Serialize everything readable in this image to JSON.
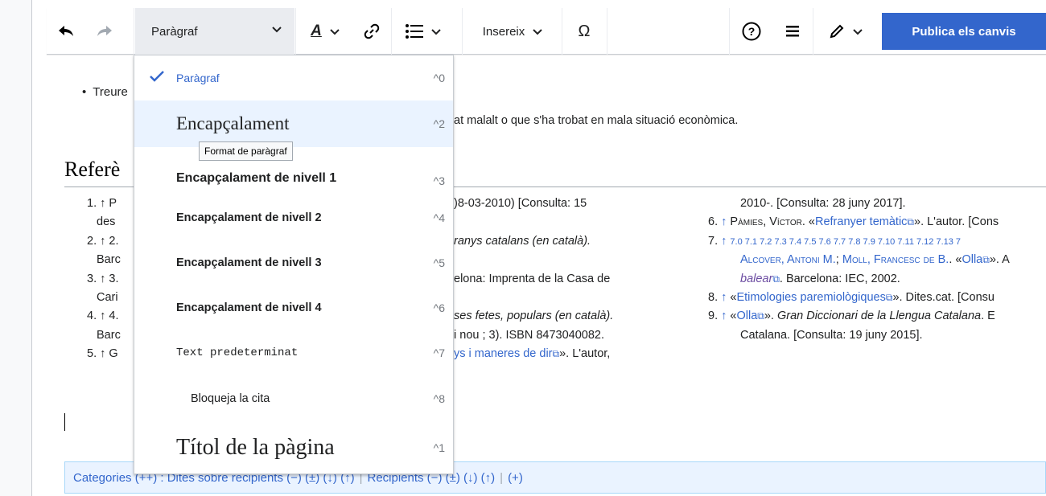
{
  "toolbar": {
    "undo_icon": "undo-arrow",
    "redo_icon": "redo-arrow",
    "paragraph_label": "Paràgraf",
    "style_icon": "text-style-A",
    "link_icon": "link-chain",
    "list_icon": "bulleted-list",
    "insert_label": "Insereix",
    "special_char_label": "Ω",
    "help_icon": "question-circle",
    "menu_icon": "hamburger",
    "edit_icon": "pencil",
    "publish_label": "Publica els canvis",
    "accent_color": "#3366cc"
  },
  "content": {
    "bullet_text": "Treure",
    "frag1": "at malalt o que s'ha trobat en mala situació econòmica.",
    "heading": "Referè",
    "left_refs": [
      "1. ↑ P",
      "des",
      "2. ↑ 2.",
      "Barc",
      "3. ↑ 3.",
      "Cari",
      "4. ↑ 4.",
      "Barc",
      "5. ↑ G"
    ],
    "mid_refs": [
      ")8-03-2010) [Consulta: 15",
      "",
      "ranys catalans (en català).",
      "",
      "elona: Imprenta de la Casa de",
      "",
      "ses fetes, populars (en català).",
      "i nou ; 3). ISBN 8473040082.",
      "ys i maneres de dir"
    ],
    "mid_ref8_suffix": "». L'autor,",
    "right_refs": {
      "r0": "2010-. [Consulta: 28 juny 2017].",
      "r6_num": "6.",
      "r6_author": "Pàmies, Víctor",
      "r6_link": "Refranyer temàtic",
      "r6_tail": "». L'autor. [Cons",
      "r7_num": "7.",
      "r7_sup": "7.0 7.1 7.2 7.3 7.4 7.5 7.6 7.7 7.8 7.9 7.10 7.11 7.12 7.13 7",
      "r7_author1": "Alcover, Antoni M.",
      "r7_author2": "Moll, Francesc de B.",
      "r7_link": "Olla",
      "r7_tail": "». A",
      "r7b_link": "balear",
      "r7b_tail": ". Barcelona: IEC, 2002.",
      "r8_num": "8.",
      "r8_link": "Etimologies paremiològiques",
      "r8_tail": "». Dites.cat. [Consu",
      "r9_num": "9.",
      "r9_link": "Olla",
      "r9_tail": "Gran Diccionari de la Llengua Catalana",
      "r9_tail2": ". E",
      "r9b": "Catalana. [Consulta: 19 juny 2015]."
    }
  },
  "categories": {
    "label": "Categories (++) : Dites sobre recipients (−) (±) (↓) (↑)",
    "item2": "Recipients (−) (±) (↓) (↑)",
    "add": "(+)"
  },
  "dropdown": {
    "items": [
      {
        "label": "Paràgraf",
        "shortcut": "^0",
        "checked": true
      },
      {
        "label": "Encapçalament",
        "shortcut": "^2"
      },
      {
        "label": "Encapçalament de nivell 1",
        "shortcut": "^3"
      },
      {
        "label": "Encapçalament de nivell 2",
        "shortcut": "^4"
      },
      {
        "label": "Encapçalament de nivell 3",
        "shortcut": "^5"
      },
      {
        "label": "Encapçalament de nivell 4",
        "shortcut": "^6"
      },
      {
        "label": "Text predeterminat",
        "shortcut": "^7"
      },
      {
        "label": "Bloqueja la cita",
        "shortcut": "^8"
      },
      {
        "label": "Títol de la pàgina",
        "shortcut": "^1"
      }
    ],
    "tooltip": "Format de paràgraf"
  }
}
